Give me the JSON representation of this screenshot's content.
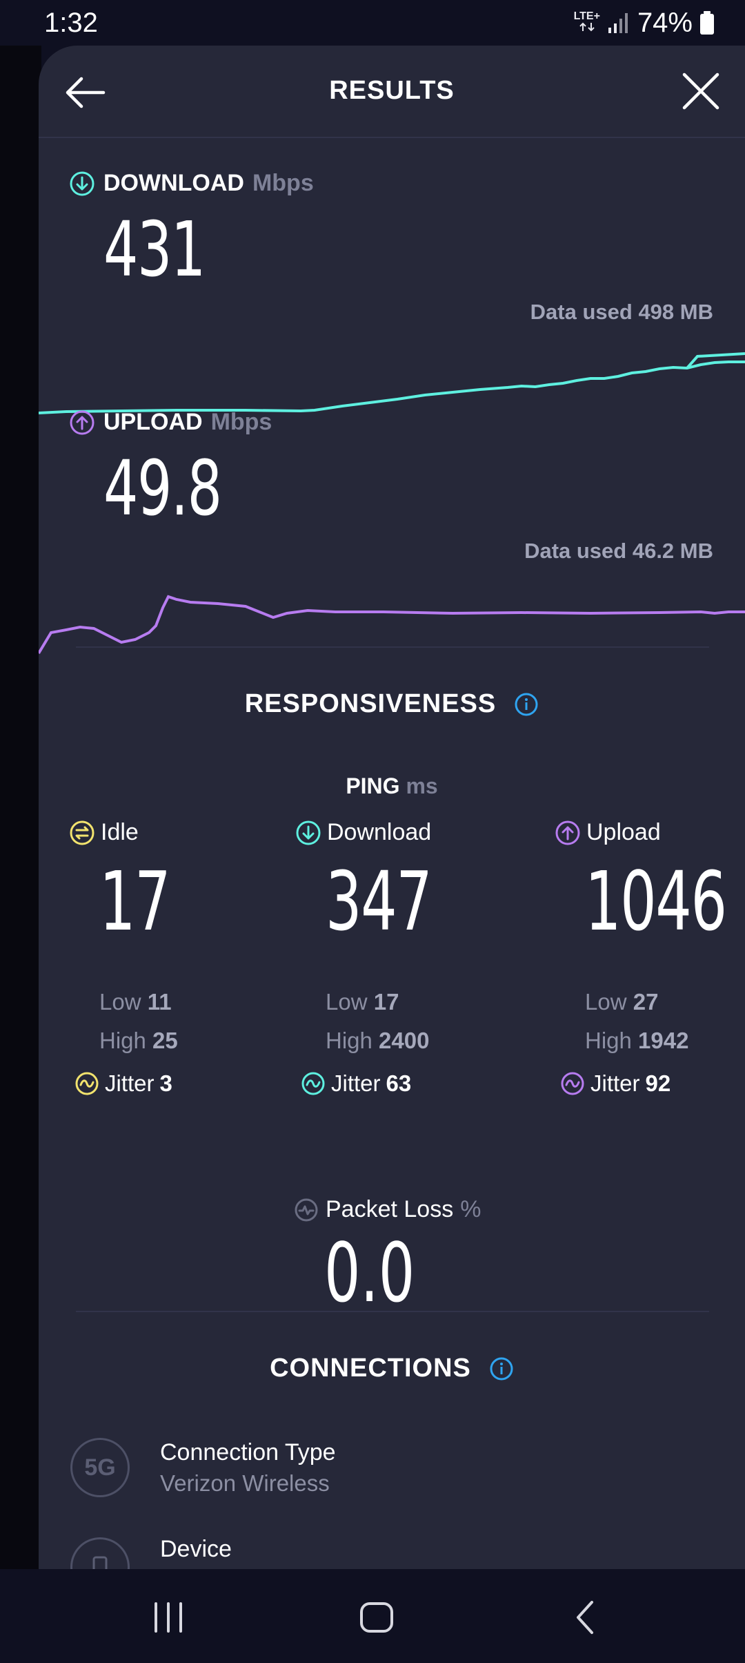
{
  "status_bar": {
    "time": "1:32",
    "network": "LTE+",
    "battery": "74%"
  },
  "header": {
    "title": "RESULTS"
  },
  "download": {
    "label": "DOWNLOAD",
    "unit": "Mbps",
    "value": "431",
    "data_used": "Data used 498 MB",
    "color": "#5ef0e0"
  },
  "upload": {
    "label": "UPLOAD",
    "unit": "Mbps",
    "value": "49.8",
    "data_used": "Data used 46.2 MB",
    "color": "#b77cf0"
  },
  "responsiveness": {
    "title": "RESPONSIVENESS",
    "ping_label": "PING",
    "ping_unit": "ms",
    "columns": [
      {
        "name": "Idle",
        "value": "17",
        "low_label": "Low",
        "low": "11",
        "high_label": "High",
        "high": "25",
        "jitter_label": "Jitter",
        "jitter": "3",
        "color": "#f2e36e"
      },
      {
        "name": "Download",
        "value": "347",
        "low_label": "Low",
        "low": "17",
        "high_label": "High",
        "high": "2400",
        "jitter_label": "Jitter",
        "jitter": "63",
        "color": "#5ef0e0"
      },
      {
        "name": "Upload",
        "value": "1046",
        "low_label": "Low",
        "low": "27",
        "high_label": "High",
        "high": "1942",
        "jitter_label": "Jitter",
        "jitter": "92",
        "color": "#b77cf0"
      }
    ],
    "packet_loss_label": "Packet Loss",
    "packet_loss_unit": "%",
    "packet_loss_value": "0.0"
  },
  "connections": {
    "title": "CONNECTIONS",
    "items": [
      {
        "badge": "5G",
        "title": "Connection Type",
        "subtitle": "Verizon Wireless"
      },
      {
        "badge": "",
        "title": "Device",
        "subtitle": ""
      }
    ]
  },
  "colors": {
    "background": "#262839",
    "accent_info": "#2fa4f0"
  }
}
